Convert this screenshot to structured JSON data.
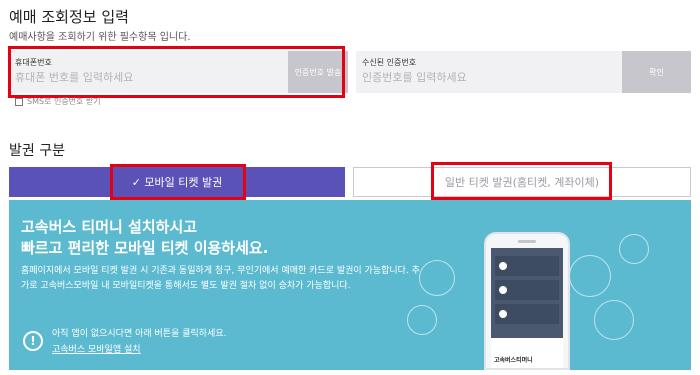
{
  "header": {
    "title": "예매 조회정보 입력",
    "subtitle": "예매사항을 조회하기 위한 필수항목 입니다."
  },
  "phone_form": {
    "label": "휴대폰번호",
    "placeholder": "휴대폰 번호를 입력하세요",
    "send_button": "인증번호 발송",
    "sms_checkbox": "SMS로 인증번호 받기"
  },
  "code_form": {
    "label": "수신된 인증번호",
    "placeholder": "인증번호를 입력하세요",
    "confirm_button": "확인"
  },
  "issuance": {
    "title": "발권 구분",
    "mobile_tab": "✓ 모바일 티켓 발권",
    "general_tab": "일반 티켓 발권(홈티켓, 계좌이체)"
  },
  "banner": {
    "headline_1": "고속버스 티머니 설치하시고",
    "headline_2": "빠르고 편리한 모바일 티켓 이용하세요.",
    "description": "홈페이지에서 모바일 티켓 발권 시 기존과 동일하게 청구, 무인기에서 예매한 카드로 발권이 가능합니다. 추가로 고속버스모바일 내 모바일티켓을 통해서도 별도 발권 절차 없이 승차가 가능합니다.",
    "notice": "아직 앱이 없으시다면 아래 버튼을 클릭하세요.",
    "install_link": "고속버스 모바일앱 설치",
    "phone_brand": "고속버스티머니"
  },
  "colors": {
    "accent": "#5b52b8",
    "banner": "#5cbad0",
    "highlight": "#e50012"
  }
}
